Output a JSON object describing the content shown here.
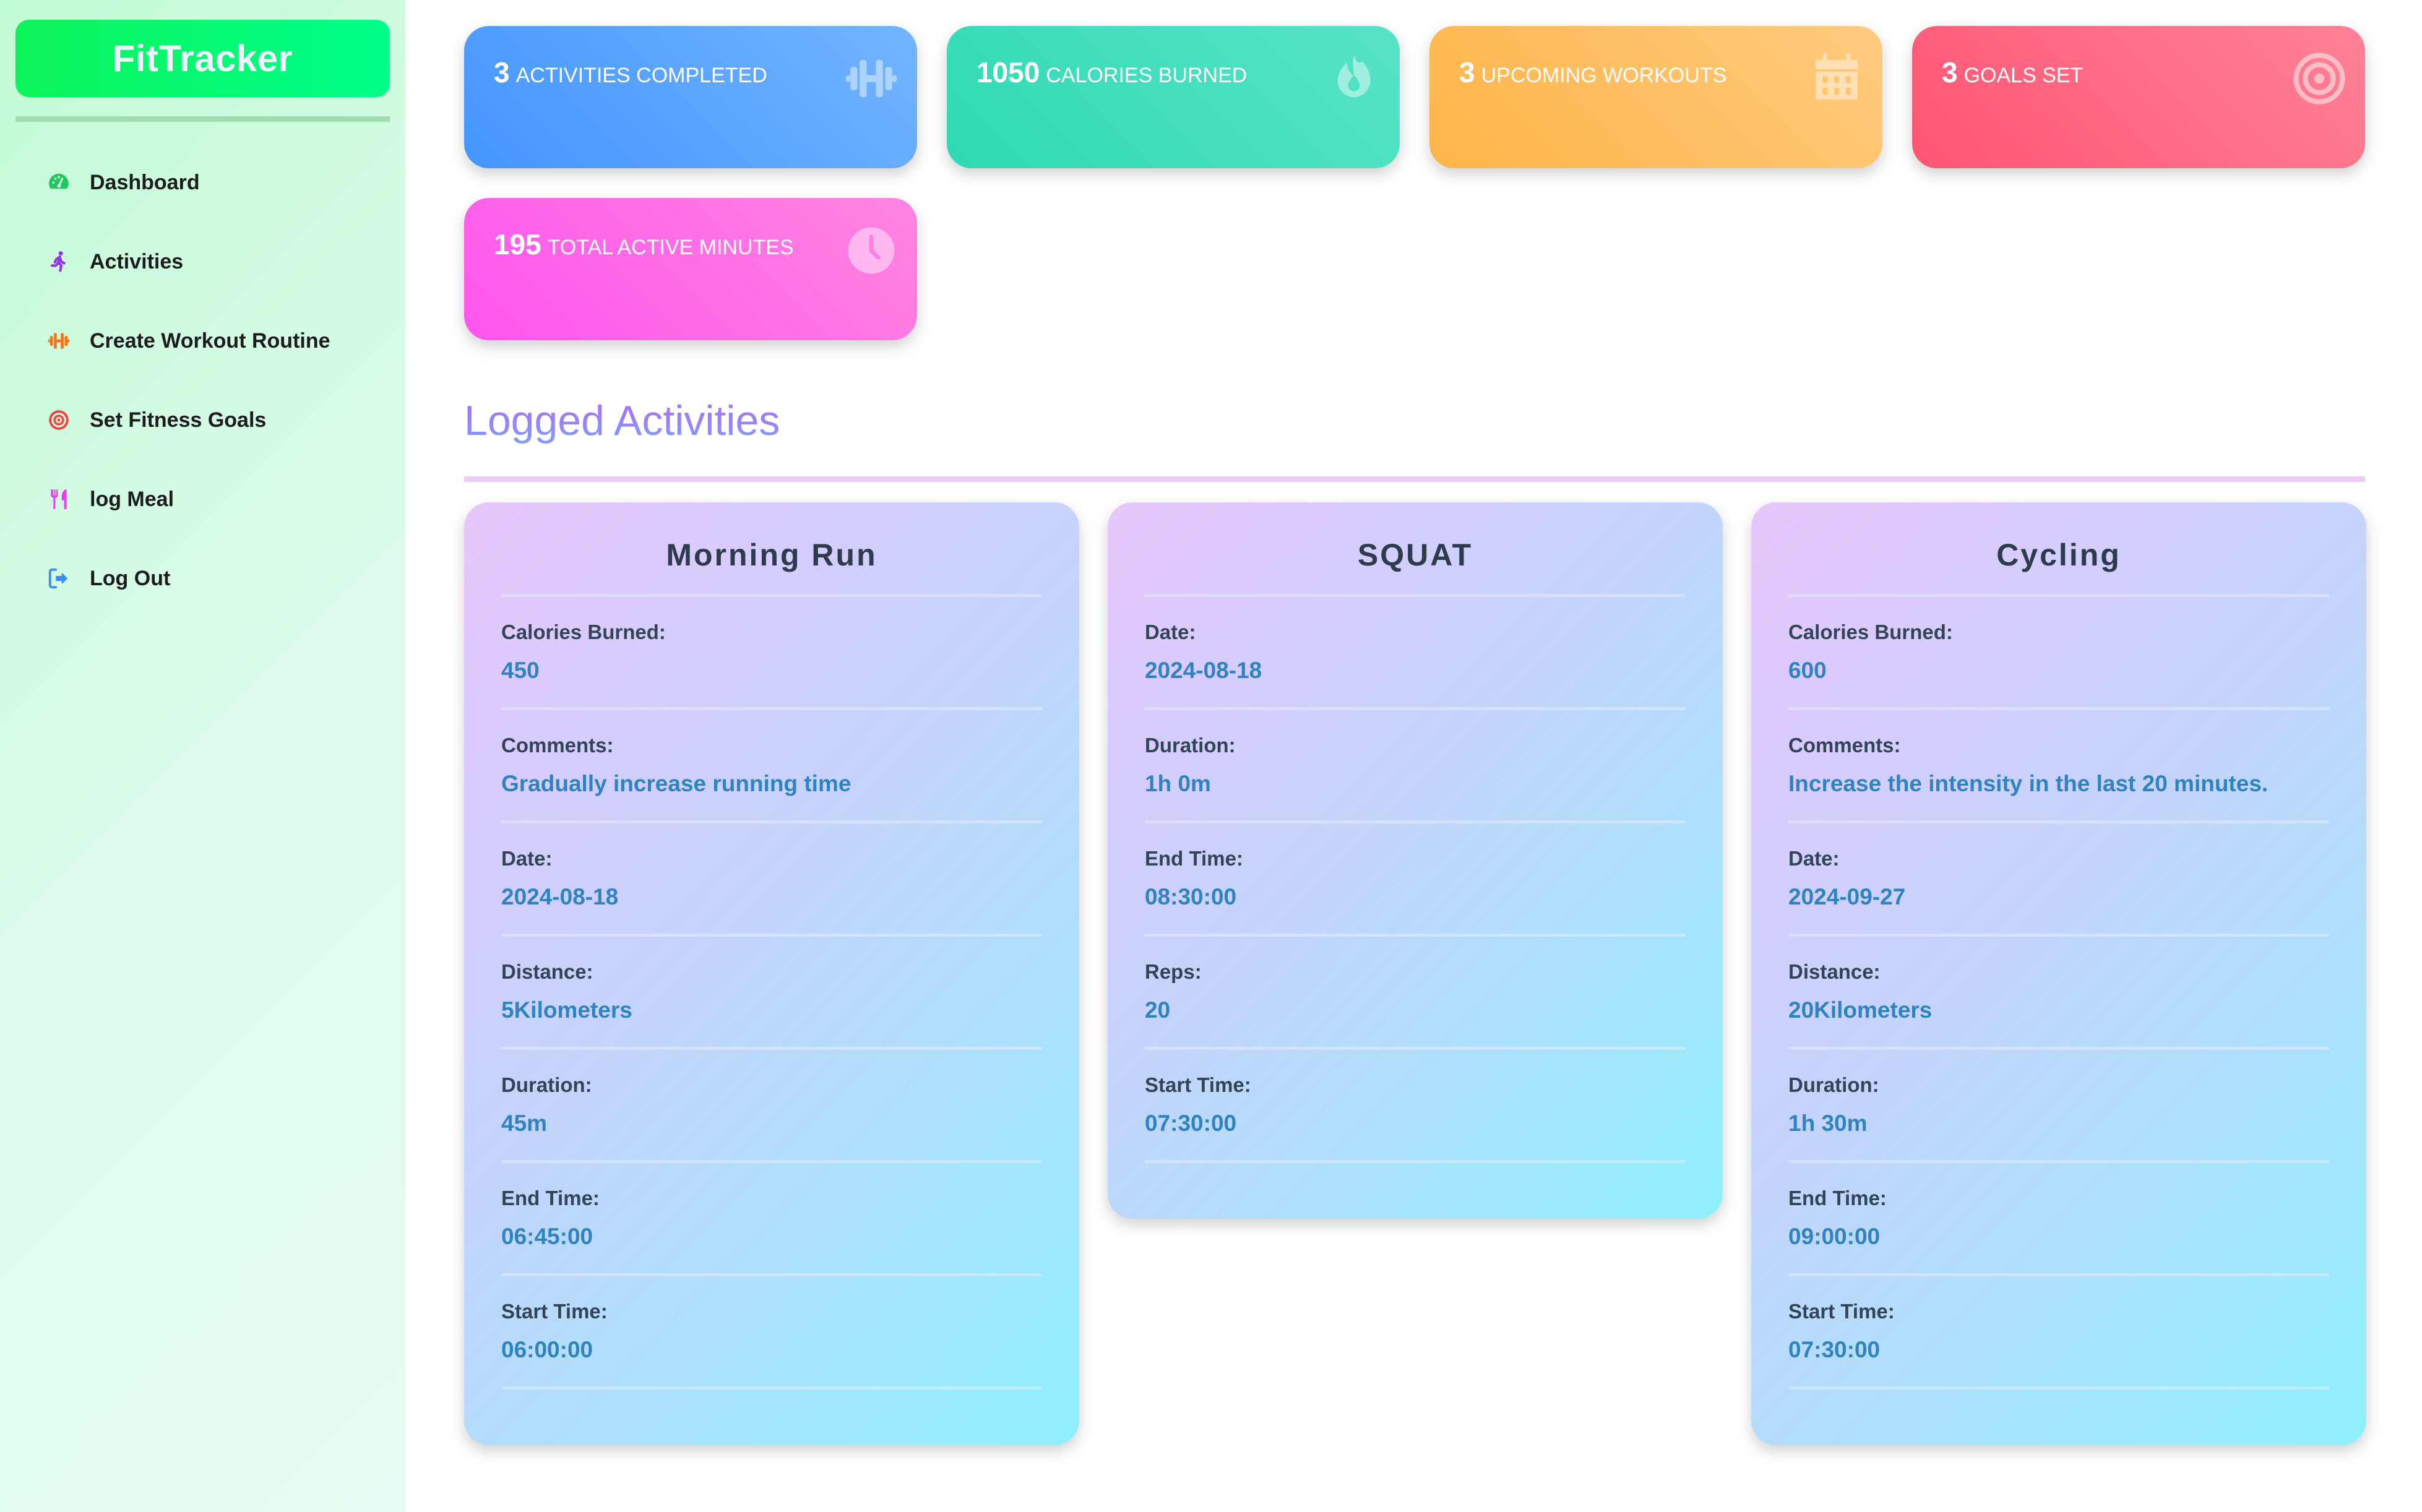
{
  "app": {
    "title": "FitTracker"
  },
  "sidebar": {
    "items": [
      {
        "label": "Dashboard",
        "icon": "gauge-icon",
        "color": "#22c55e"
      },
      {
        "label": "Activities",
        "icon": "running-icon",
        "color": "#9333ea"
      },
      {
        "label": "Create Workout Routine",
        "icon": "dumbbell-icon",
        "color": "#f97316"
      },
      {
        "label": "Set Fitness Goals",
        "icon": "target-icon",
        "color": "#ef4444"
      },
      {
        "label": "log Meal",
        "icon": "utensils-icon",
        "color": "#e83ef0"
      },
      {
        "label": "Log Out",
        "icon": "logout-icon",
        "color": "#3b8cf6"
      }
    ]
  },
  "stats": [
    {
      "value": "3",
      "label": "Activities Completed",
      "icon": "dumbbell-icon"
    },
    {
      "value": "1050",
      "label": "Calories Burned",
      "icon": "fire-icon"
    },
    {
      "value": "3",
      "label": "Upcoming Workouts",
      "icon": "calendar-icon"
    },
    {
      "value": "3",
      "label": "Goals Set",
      "icon": "target-icon"
    },
    {
      "value": "195",
      "label": "Total Active Minutes",
      "icon": "clock-icon"
    }
  ],
  "main": {
    "section_title": "Logged Activities",
    "activities": [
      {
        "name": "Morning Run",
        "fields": [
          {
            "label": "Calories Burned:",
            "value": "450"
          },
          {
            "label": "Comments:",
            "value": "Gradually increase running time"
          },
          {
            "label": "Date:",
            "value": "2024-08-18"
          },
          {
            "label": "Distance:",
            "value": "5Kilometers"
          },
          {
            "label": "Duration:",
            "value": "45m"
          },
          {
            "label": "End Time:",
            "value": "06:45:00"
          },
          {
            "label": "Start Time:",
            "value": "06:00:00"
          }
        ]
      },
      {
        "name": "SQUAT",
        "fields": [
          {
            "label": "Date:",
            "value": "2024-08-18"
          },
          {
            "label": "Duration:",
            "value": "1h 0m"
          },
          {
            "label": "End Time:",
            "value": "08:30:00"
          },
          {
            "label": "Reps:",
            "value": "20"
          },
          {
            "label": "Start Time:",
            "value": "07:30:00"
          }
        ]
      },
      {
        "name": "Cycling",
        "fields": [
          {
            "label": "Calories Burned:",
            "value": "600"
          },
          {
            "label": "Comments:",
            "value": "Increase the intensity in the last 20 minutes."
          },
          {
            "label": "Date:",
            "value": "2024-09-27"
          },
          {
            "label": "Distance:",
            "value": "20Kilometers"
          },
          {
            "label": "Duration:",
            "value": "1h 30m"
          },
          {
            "label": "End Time:",
            "value": "09:00:00"
          },
          {
            "label": "Start Time:",
            "value": "07:30:00"
          }
        ]
      }
    ]
  }
}
